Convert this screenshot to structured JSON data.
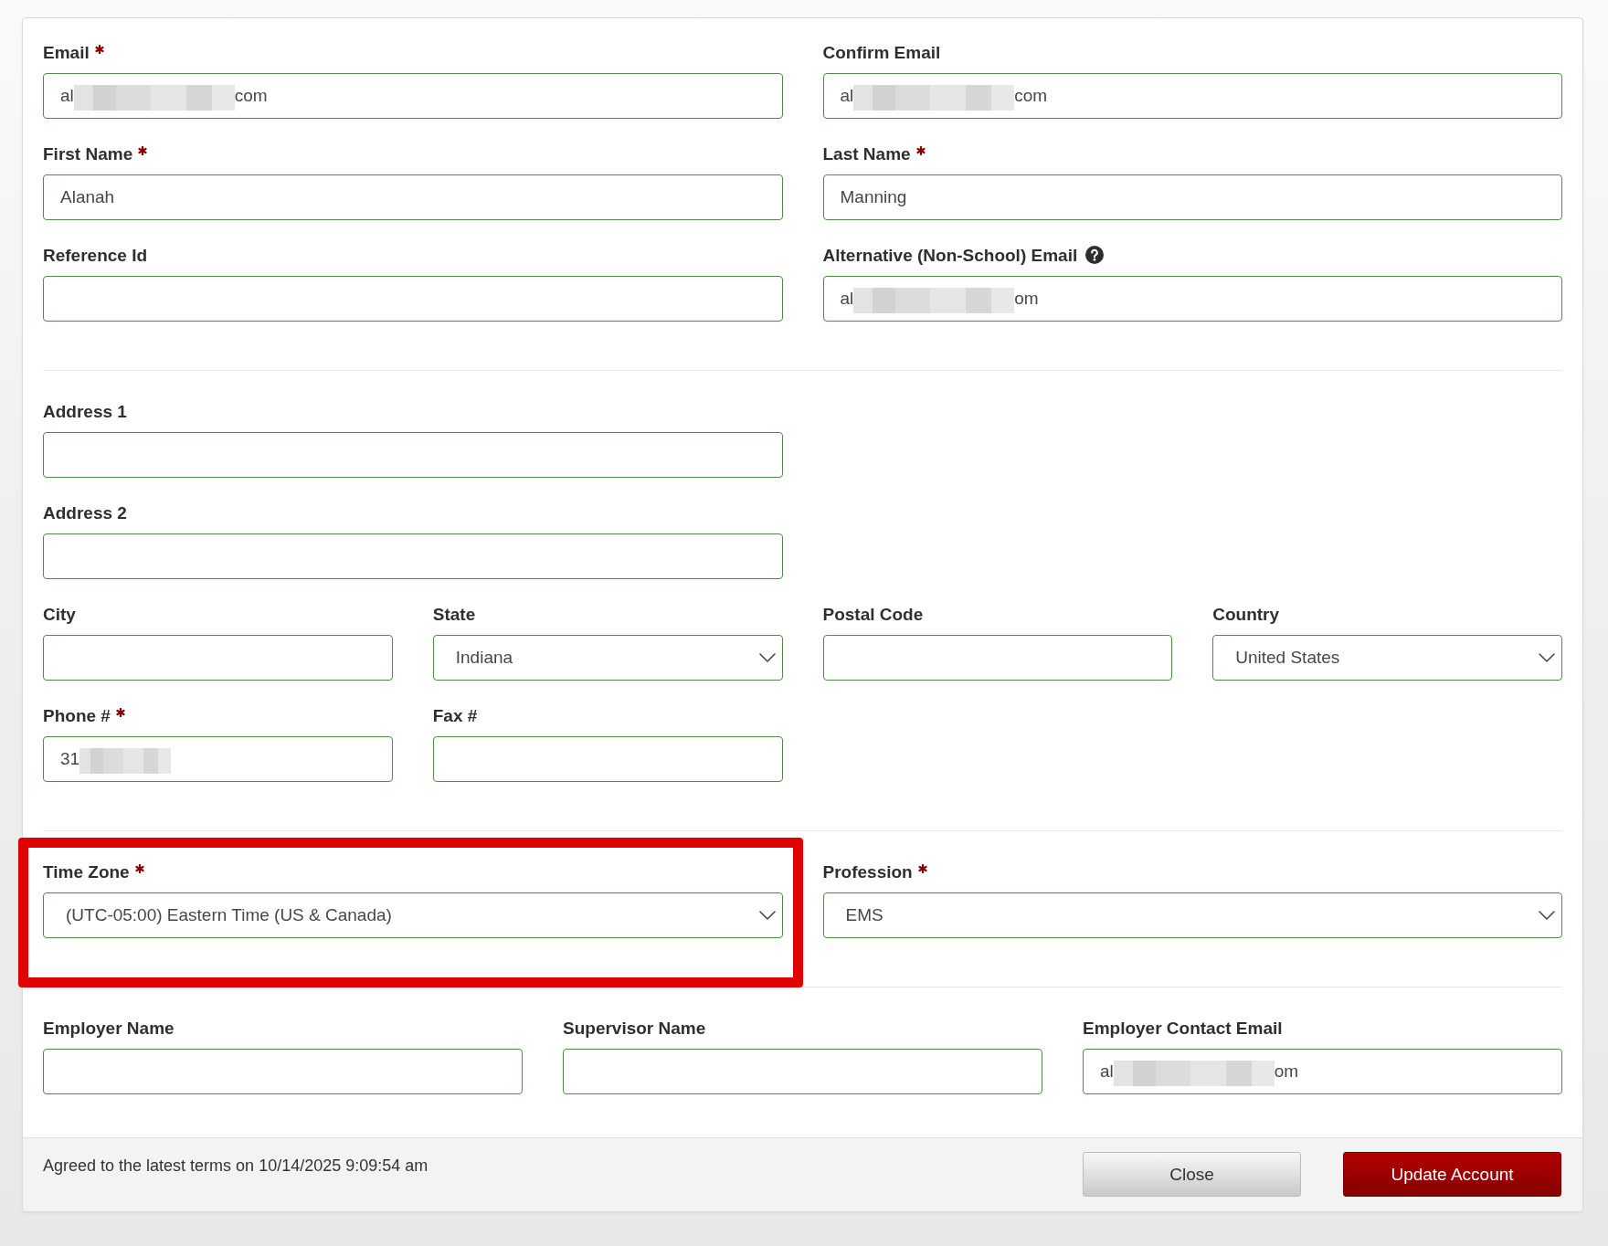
{
  "sections": [
    {
      "rows": [
        [
          {
            "kind": "text",
            "label": "Email",
            "required": true,
            "value": "al",
            "value_end": "com",
            "redacted": true
          },
          {
            "kind": "text",
            "label": "Confirm Email",
            "required": false,
            "value": "al",
            "value_end": "com",
            "redacted": true
          }
        ],
        [
          {
            "kind": "text",
            "label": "First Name",
            "required": true,
            "value": "Alanah"
          },
          {
            "kind": "text",
            "label": "Last Name",
            "required": true,
            "value": "Manning"
          }
        ],
        [
          {
            "kind": "text",
            "label": "Reference Id",
            "required": false
          },
          {
            "kind": "text",
            "label": "Alternative (Non-School) Email",
            "required": false,
            "help": true,
            "value": "al",
            "value_end": "om",
            "redacted": true
          }
        ]
      ]
    },
    {
      "rows": [
        [
          {
            "kind": "text",
            "label": "Address 1",
            "required": false
          }
        ],
        [
          {
            "kind": "text",
            "label": "Address 2",
            "required": false
          }
        ],
        [
          {
            "kind": "text",
            "label": "City",
            "required": false
          },
          {
            "kind": "select",
            "label": "State",
            "required": false,
            "value": "Indiana"
          },
          {
            "kind": "text",
            "label": "Postal Code",
            "required": false
          },
          {
            "kind": "select",
            "label": "Country",
            "required": false,
            "value": "United States"
          }
        ],
        [
          {
            "kind": "text",
            "label": "Phone #",
            "required": true,
            "value": "31",
            "redacted": true
          },
          {
            "kind": "text",
            "label": "Fax #",
            "required": false
          }
        ]
      ]
    },
    {
      "rows": [
        [
          {
            "kind": "select",
            "label": "Time Zone",
            "required": true,
            "highlighted": true,
            "value": "(UTC-05:00) Eastern Time (US & Canada)"
          },
          {
            "kind": "select",
            "label": "Profession",
            "required": true,
            "value": "EMS"
          }
        ]
      ]
    },
    {
      "rows": [
        [
          {
            "kind": "text",
            "label": "Employer Name",
            "required": false
          },
          {
            "kind": "text",
            "label": "Supervisor Name",
            "required": false
          },
          {
            "kind": "text",
            "label": "Employer Contact Email",
            "required": false,
            "value": "al",
            "value_end": "om",
            "redacted": true
          }
        ]
      ]
    }
  ],
  "footer": {
    "terms_text": "Agreed to the latest terms on 10/14/2025 9:09:54 am",
    "buttons": [
      {
        "label": "Close",
        "kind": "secondary"
      },
      {
        "label": "Update Account",
        "kind": "primary"
      }
    ]
  }
}
